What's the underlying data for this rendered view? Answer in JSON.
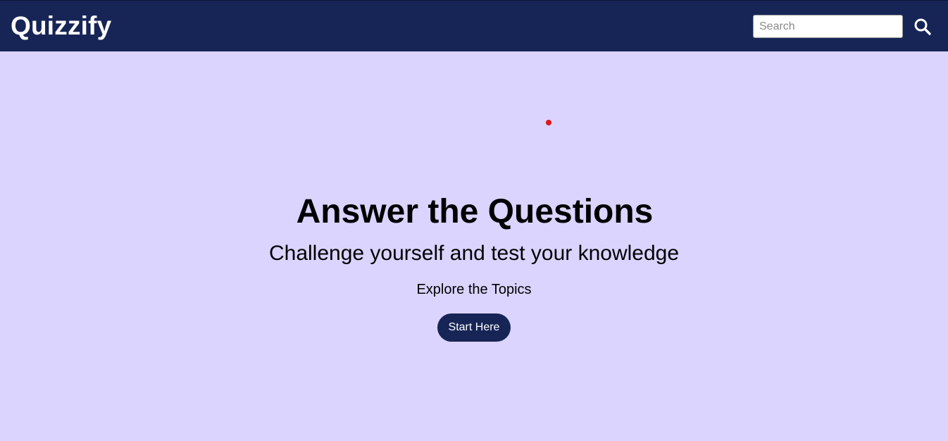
{
  "navbar": {
    "brand": "Quizzify",
    "search": {
      "placeholder": "Search",
      "value": ""
    },
    "search_icon": "search-icon"
  },
  "hero": {
    "title": "Answer the Questions",
    "subtitle": "Challenge yourself and test your knowledge",
    "explore_text": "Explore the Topics",
    "start_button_label": "Start Here"
  },
  "colors": {
    "navbar_bg": "#172556",
    "page_bg": "#dbd4ff",
    "button_bg": "#172556",
    "dot": "#e0151b"
  }
}
